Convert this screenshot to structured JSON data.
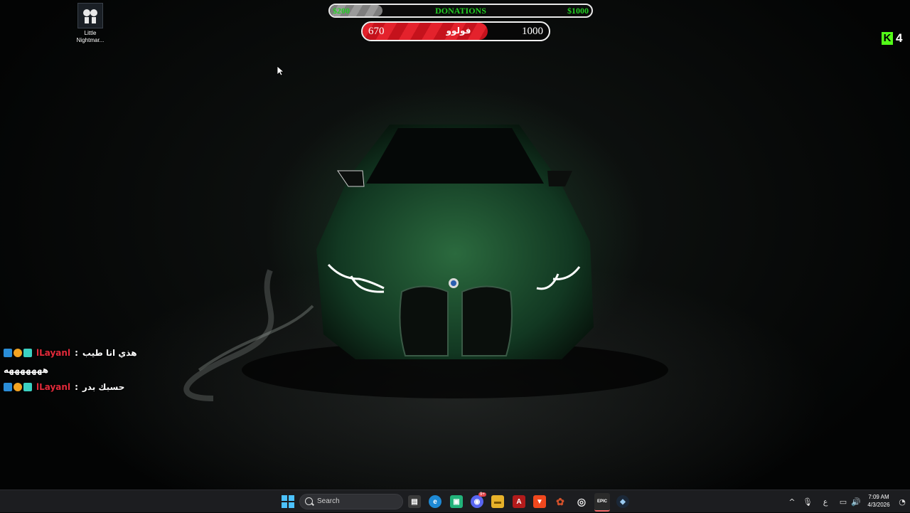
{
  "desktop": {
    "icons": [
      {
        "label": "Little Nightmar...",
        "icon": "little-nightmares-game-icon"
      }
    ]
  },
  "overlays": {
    "donations": {
      "min_label": "$200",
      "title": "DONATIONS",
      "max_label": "$1000",
      "progress": 0.2,
      "text_color": "#23d023"
    },
    "follow_goal": {
      "current": "670",
      "label": "فولوو",
      "goal": "1000",
      "progress": 0.67,
      "fill_color": "#e4222c"
    },
    "kick": {
      "icon": "kick-logo-icon",
      "letter": "K",
      "viewers": "4",
      "color": "#53fc18"
    }
  },
  "chat": {
    "messages": [
      {
        "user": "lLayanl",
        "sep": ":",
        "text": "هذي انا طيب",
        "continuation": "هههههههه"
      },
      {
        "user": "lLayanl",
        "sep": ":",
        "text": "حسبك بدر",
        "continuation": ""
      }
    ],
    "user_color": "#e22a3a"
  },
  "taskbar": {
    "search_placeholder": "Search",
    "pinned_apps": [
      {
        "name": "store-icon",
        "color": "#3a3a3a",
        "glyph": "▤"
      },
      {
        "name": "edge-icon",
        "color": "#1e8ad6",
        "glyph": "e"
      },
      {
        "name": "screen-capture-icon",
        "color": "#22b27a",
        "glyph": "▣"
      },
      {
        "name": "discord-icon",
        "color": "#5865f2",
        "glyph": "◉",
        "badge": "9+"
      },
      {
        "name": "file-explorer-icon",
        "color": "#e8b22a",
        "glyph": "▬"
      },
      {
        "name": "adobe-acrobat-icon",
        "color": "#b31b1b",
        "glyph": "A"
      },
      {
        "name": "brave-browser-icon",
        "color": "#f0481e",
        "glyph": "▼"
      },
      {
        "name": "paint-app-icon",
        "color": "#d0502a",
        "glyph": "✿"
      },
      {
        "name": "obs-studio-icon",
        "color": "#444444",
        "glyph": "◎"
      },
      {
        "name": "epic-games-icon",
        "color": "#2a2a2a",
        "glyph": "EPIC"
      },
      {
        "name": "steam-icon",
        "color": "#1b2838",
        "glyph": "◆"
      }
    ],
    "tray": {
      "keyboard_language": "ع",
      "time": "7:09 AM",
      "date": "4/3/2026"
    }
  }
}
